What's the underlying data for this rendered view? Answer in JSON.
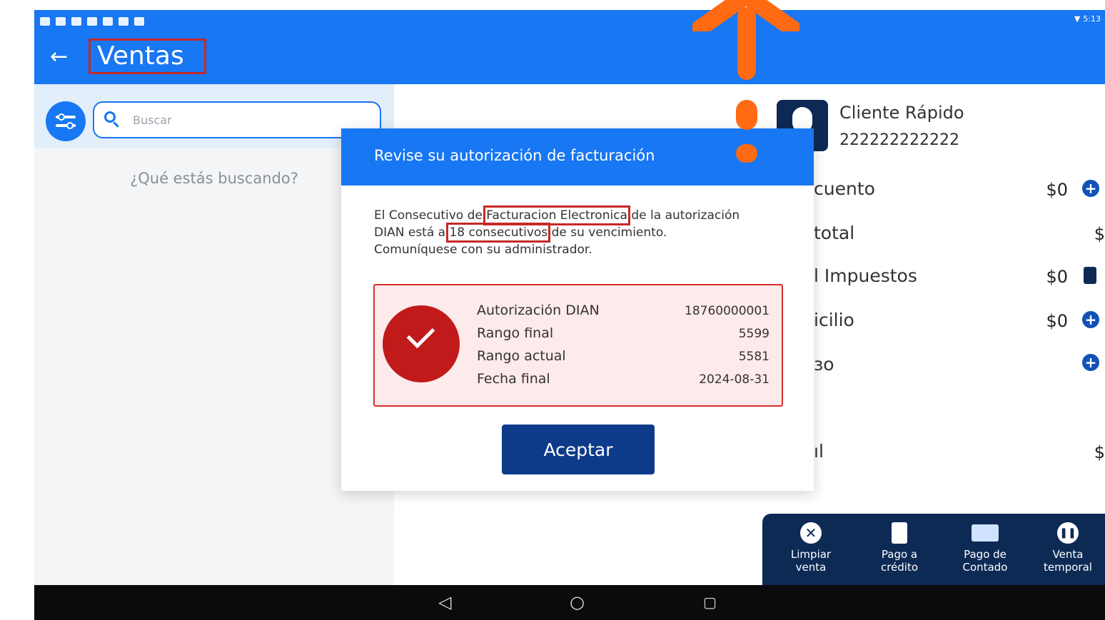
{
  "app": {
    "title": "Ventas",
    "status_time": "5:13"
  },
  "search": {
    "placeholder": "Buscar",
    "empty_text": "¿Qué estás buscando?"
  },
  "client": {
    "name": "Cliente Rápido",
    "id": "222222222222"
  },
  "summary_rows": [
    {
      "label": "cuento",
      "value": "$0"
    },
    {
      "label": "total",
      "value": "$"
    },
    {
      "label": "l Impuestos",
      "value": "$0"
    },
    {
      "label": "icilio",
      "value": "$0"
    },
    {
      "label": "ɜo",
      "value": ""
    },
    {
      "label": "ıl",
      "value": "$"
    }
  ],
  "toolbar": [
    {
      "label": "Limpiar\nventa",
      "icon": "clear-icon"
    },
    {
      "label": "Pago a\ncrédito",
      "icon": "notebook-icon"
    },
    {
      "label": "Pago de\nContado",
      "icon": "cash-icon"
    },
    {
      "label": "Venta\ntemporal",
      "icon": "pause-icon"
    }
  ],
  "dialog": {
    "title": "Revise su autorización de facturación",
    "message_part1": "El Consecutivo de ",
    "message_hl1": "Facturacion Electronica",
    "message_part2": " de la autorización DIAN está a ",
    "message_hl2": "18 consecutivos",
    "message_part3": " de su vencimiento. Comuníquese con su administrador.",
    "info": [
      {
        "label": "Autorización DIAN",
        "value": "18760000001"
      },
      {
        "label": "Rango final",
        "value": "5599"
      },
      {
        "label": "Rango actual",
        "value": "5581"
      },
      {
        "label": "Fecha final",
        "value": "2024-08-31"
      }
    ],
    "accept_label": "Aceptar"
  },
  "colors": {
    "primary": "#1877f2",
    "dark_navy": "#0d2a55",
    "alert_red": "#c11a1a",
    "annotation_orange": "#ff6a13"
  }
}
